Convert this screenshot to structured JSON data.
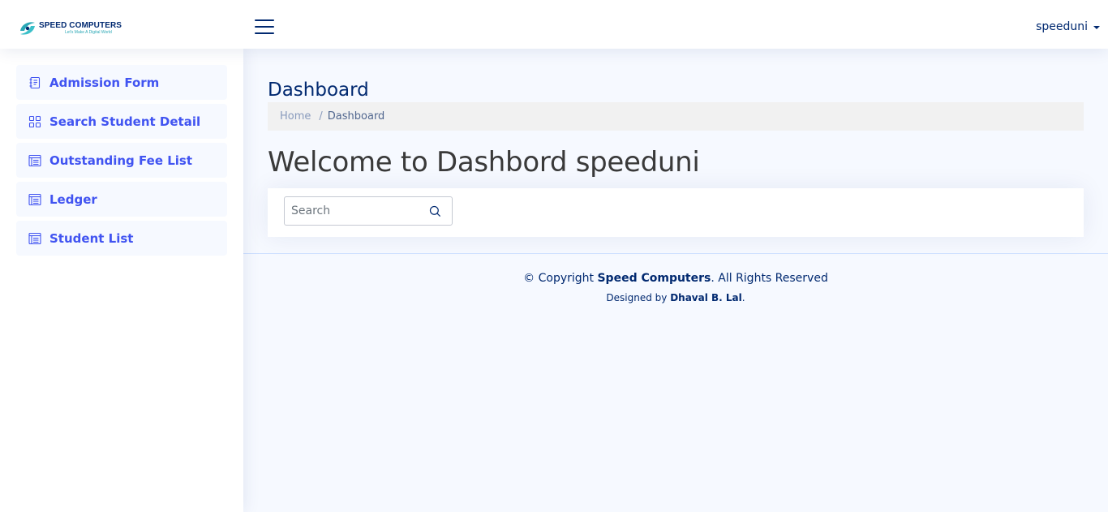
{
  "header": {
    "logo_title": "SPEED COMPUTERS",
    "logo_tagline": "Let's Make A Digital World",
    "user_name": "speeduni"
  },
  "sidebar": {
    "items": [
      {
        "label": "Admission Form",
        "icon": "journal-text-icon"
      },
      {
        "label": "Search Student Detail",
        "icon": "grid-icon"
      },
      {
        "label": "Outstanding Fee List",
        "icon": "list-layout-icon"
      },
      {
        "label": "Ledger",
        "icon": "list-layout-icon"
      },
      {
        "label": "Student List",
        "icon": "list-layout-icon"
      }
    ]
  },
  "main": {
    "page_title": "Dashboard",
    "breadcrumb": {
      "home": "Home",
      "separator": "/",
      "current": "Dashboard"
    },
    "welcome": "Welcome to Dashbord speeduni",
    "search": {
      "placeholder": "Search",
      "value": ""
    }
  },
  "footer": {
    "copyright_prefix": "© Copyright",
    "company": "Speed Computers",
    "copyright_suffix": ". All Rights Reserved",
    "designed_prefix": "Designed by",
    "designer": "Dhaval B. Lal",
    "designed_suffix": "."
  },
  "colors": {
    "accent": "#4154f1",
    "navy": "#012970",
    "background": "#f6f9ff"
  }
}
